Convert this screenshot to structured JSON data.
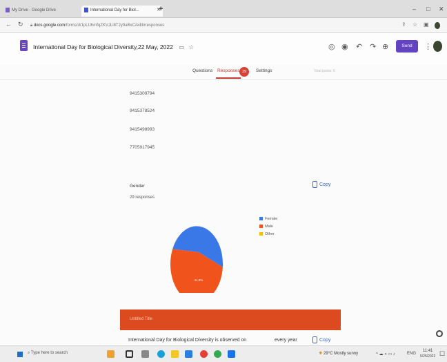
{
  "browser": {
    "tabs": [
      {
        "label": "My Drive - Google Drive"
      },
      {
        "label": "International Day for Biol..."
      }
    ],
    "new_tab": "+",
    "url_domain": "docs.google.com",
    "url_rest": "/forms/d/1pLUhmfqZKVJLi8T2y9aBxC/edit#responses"
  },
  "form": {
    "title": "International Day for Biological Diversity,22 May, 2022",
    "send_label": "Send",
    "tabs": {
      "questions": "Questions",
      "responses": "Responses",
      "settings": "Settings"
    },
    "response_count": "29",
    "faded_hint": "Total points: 0"
  },
  "answers": [
    "9415309794",
    "9415378524",
    "9415498993",
    "7705917945"
  ],
  "gender_card": {
    "title": "Gender",
    "count": "29 responses",
    "copy_label": "Copy"
  },
  "chart_data": {
    "type": "pie",
    "categories": [
      "Female",
      "Male",
      "Other"
    ],
    "values": [
      44.8,
      55.2,
      0
    ],
    "labels": [
      "44.8%",
      "55.2%"
    ],
    "colors": [
      "#3b78e7",
      "#f0531c",
      "#fbbc04"
    ]
  },
  "bottom": {
    "bar_label": "Untitled Title",
    "question_text": "International Day for Biological Diversity is observed on",
    "every_year": "every year",
    "copy_label": "Copy"
  },
  "taskbar": {
    "search_placeholder": "Type here to search",
    "weather": "29°C  Mostly sunny",
    "lang": "ENG",
    "time": "11:41",
    "date": "5/25/2022"
  }
}
